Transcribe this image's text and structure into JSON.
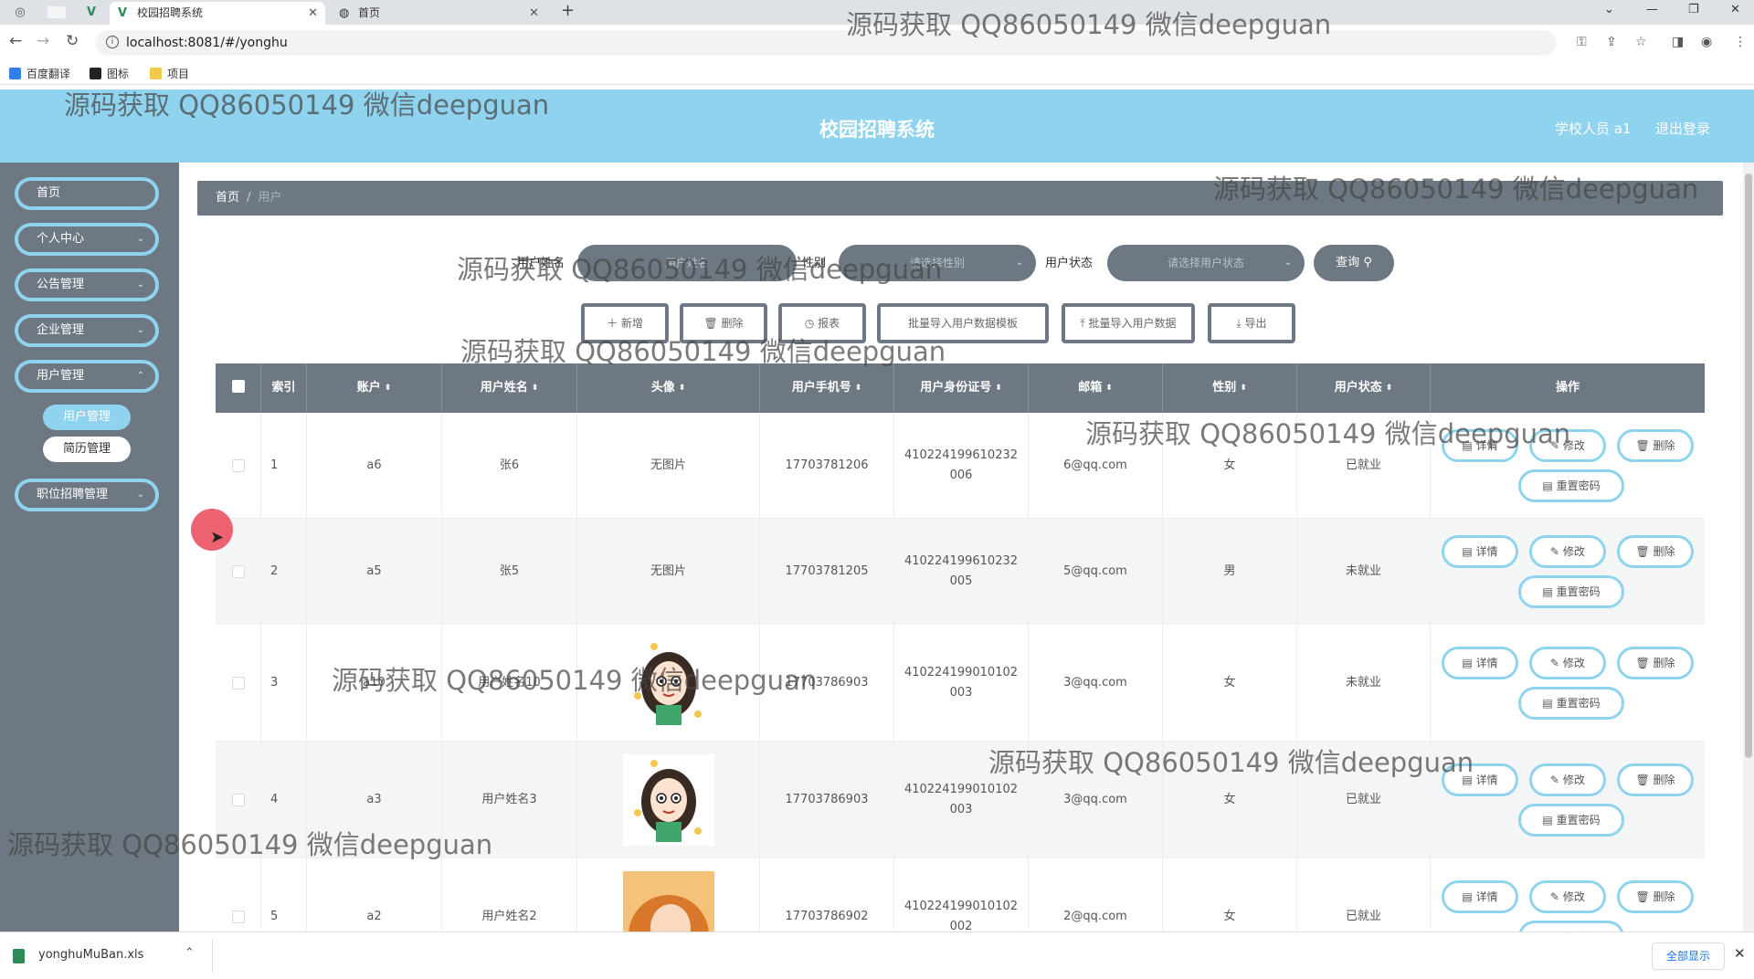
{
  "browser": {
    "tabs": [
      {
        "title": "校园招聘系统",
        "active": true
      },
      {
        "title": "首页",
        "active": false
      }
    ],
    "new_tab": "+",
    "url": "localhost:8081/#/yonghu",
    "bookmarks": [
      {
        "label": "百度翻译",
        "icon": "translate-icon",
        "color": "#2f80ed"
      },
      {
        "label": "图标",
        "icon": "bookmark-icon",
        "color": "#222222"
      },
      {
        "label": "项目",
        "icon": "folder-icon",
        "color": "#f2c94c"
      }
    ]
  },
  "header": {
    "title": "校园招聘系统",
    "user": "学校人员 a1",
    "logout": "退出登录"
  },
  "sidebar": {
    "items": [
      {
        "label": "首页",
        "has_children": false
      },
      {
        "label": "个人中心",
        "has_children": true
      },
      {
        "label": "公告管理",
        "has_children": true
      },
      {
        "label": "企业管理",
        "has_children": true
      },
      {
        "label": "用户管理",
        "has_children": true
      },
      {
        "label": "职位招聘管理",
        "has_children": true
      }
    ],
    "sub_items": [
      {
        "label": "用户管理",
        "active": true
      },
      {
        "label": "简历管理",
        "active": false
      }
    ]
  },
  "breadcrumb": {
    "home": "首页",
    "separator": "/",
    "current": "用户"
  },
  "search": {
    "name_label": "用户姓名",
    "name_placeholder": "用户姓名",
    "gender_label": "性别",
    "gender_placeholder": "请选择性别",
    "status_label": "用户状态",
    "status_placeholder": "请选择用户状态",
    "query_button": "查询"
  },
  "actions": {
    "add": "新增",
    "delete": "删除",
    "report": "报表",
    "import_template": "批量导入用户数据模板",
    "import_data": "批量导入用户数据",
    "export": "导出"
  },
  "table": {
    "columns": [
      "索引",
      "账户",
      "用户姓名",
      "头像",
      "用户手机号",
      "用户身份证号",
      "邮箱",
      "性别",
      "用户状态",
      "操作"
    ],
    "rows": [
      {
        "index": "1",
        "account": "a6",
        "name": "张6",
        "avatar": "无图片",
        "avatar_type": "none",
        "phone": "17703781206",
        "id_line1": "410224199610232",
        "id_line2": "006",
        "email": "6@qq.com",
        "gender": "女",
        "status": "已就业"
      },
      {
        "index": "2",
        "account": "a5",
        "name": "张5",
        "avatar": "无图片",
        "avatar_type": "none",
        "phone": "17703781205",
        "id_line1": "410224199610232",
        "id_line2": "005",
        "email": "5@qq.com",
        "gender": "男",
        "status": "未就业"
      },
      {
        "index": "3",
        "account": "a10",
        "name": "用户姓名10",
        "avatar": "",
        "avatar_type": "cartoon",
        "phone": "17703786903",
        "id_line1": "410224199010102",
        "id_line2": "003",
        "email": "3@qq.com",
        "gender": "女",
        "status": "未就业"
      },
      {
        "index": "4",
        "account": "a3",
        "name": "用户姓名3",
        "avatar": "",
        "avatar_type": "cartoon",
        "phone": "17703786903",
        "id_line1": "410224199010102",
        "id_line2": "003",
        "email": "3@qq.com",
        "gender": "女",
        "status": "已就业"
      },
      {
        "index": "5",
        "account": "a2",
        "name": "用户姓名2",
        "avatar": "",
        "avatar_type": "photo",
        "phone": "17703786902",
        "id_line1": "410224199010102",
        "id_line2": "002",
        "email": "2@qq.com",
        "gender": "女",
        "status": "已就业"
      }
    ],
    "row_actions": {
      "detail": "详情",
      "edit": "修改",
      "delete": "删除",
      "reset_password": "重置密码"
    }
  },
  "download": {
    "file": "yonghuMuBan.xls",
    "show_all": "全部显示"
  },
  "watermark": "源码获取 QQ86050149 微信deepguan",
  "colors": {
    "header": "#8fd3ee",
    "sidebar": "#6d7883",
    "accent": "#8fd3ee"
  }
}
